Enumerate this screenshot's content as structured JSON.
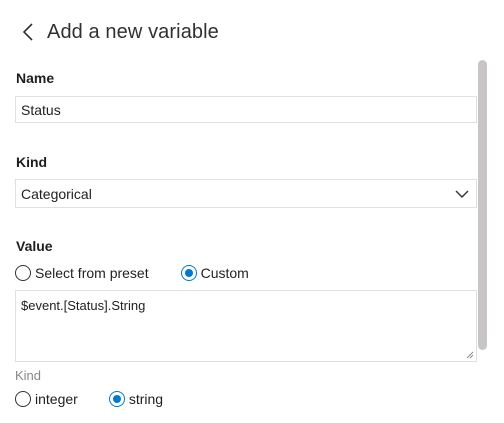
{
  "header": {
    "title": "Add a new variable"
  },
  "name_field": {
    "label": "Name",
    "value": "Status"
  },
  "kind_field": {
    "label": "Kind",
    "selected": "Categorical"
  },
  "value_field": {
    "label": "Value",
    "options": [
      "Select from preset",
      "Custom"
    ],
    "selected_option": "Custom",
    "expression": "$event.[Status].String"
  },
  "value_kind": {
    "label": "Kind",
    "options": [
      "integer",
      "string"
    ],
    "selected_option": "string"
  },
  "colors": {
    "accent": "#0078d4",
    "border": "#e1dfdd",
    "muted_text": "#8a8886"
  },
  "icons": {
    "back": "chevron-left-icon",
    "dropdown": "chevron-down-icon"
  }
}
